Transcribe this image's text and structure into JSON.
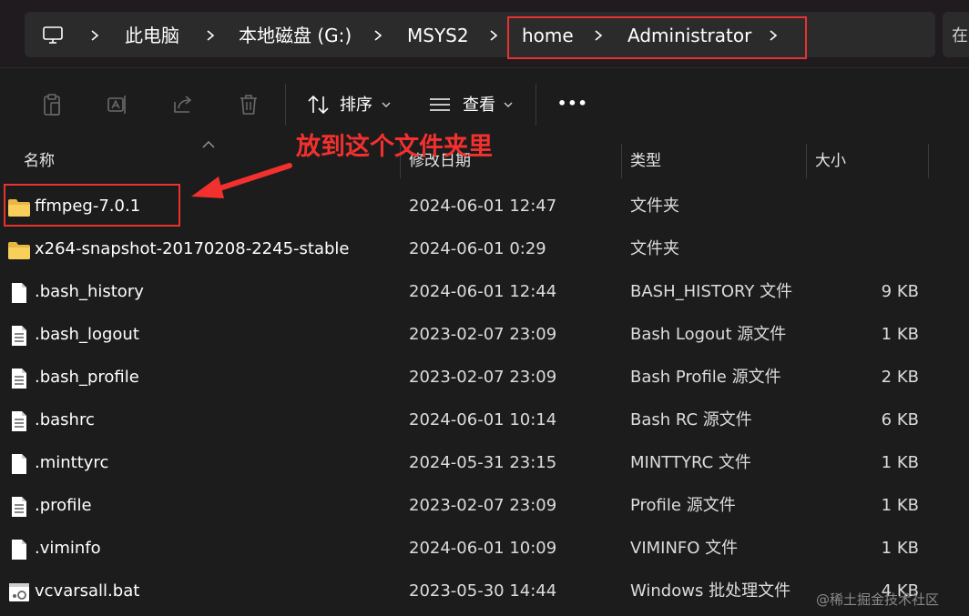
{
  "breadcrumb": {
    "items": [
      "此电脑",
      "本地磁盘 (G:)",
      "MSYS2",
      "home",
      "Administrator"
    ],
    "overflow_text": "在"
  },
  "toolbar": {
    "sort_label": "排序",
    "view_label": "查看",
    "more_label": "•••"
  },
  "columns": {
    "name": "名称",
    "modified": "修改日期",
    "type": "类型",
    "size": "大小"
  },
  "annotation": {
    "text": "放到这个文件夹里",
    "color": "#f2312f"
  },
  "files": [
    {
      "name": "ffmpeg-7.0.1",
      "modified": "2024-06-01 12:47",
      "type": "文件夹",
      "size": "",
      "icon": "folder-icon"
    },
    {
      "name": "x264-snapshot-20170208-2245-stable",
      "modified": "2024-06-01 0:29",
      "type": "文件夹",
      "size": "",
      "icon": "folder-icon"
    },
    {
      "name": ".bash_history",
      "modified": "2024-06-01 12:44",
      "type": "BASH_HISTORY 文件",
      "size": "9 KB",
      "icon": "file-icon"
    },
    {
      "name": ".bash_logout",
      "modified": "2023-02-07 23:09",
      "type": "Bash Logout 源文件",
      "size": "1 KB",
      "icon": "text-file-icon"
    },
    {
      "name": ".bash_profile",
      "modified": "2023-02-07 23:09",
      "type": "Bash Profile 源文件",
      "size": "2 KB",
      "icon": "text-file-icon"
    },
    {
      "name": ".bashrc",
      "modified": "2024-06-01 10:14",
      "type": "Bash RC 源文件",
      "size": "6 KB",
      "icon": "text-file-icon"
    },
    {
      "name": ".minttyrc",
      "modified": "2024-05-31 23:15",
      "type": "MINTTYRC 文件",
      "size": "1 KB",
      "icon": "file-icon"
    },
    {
      "name": ".profile",
      "modified": "2023-02-07 23:09",
      "type": "Profile 源文件",
      "size": "1 KB",
      "icon": "text-file-icon"
    },
    {
      "name": ".viminfo",
      "modified": "2024-06-01 10:09",
      "type": "VIMINFO 文件",
      "size": "1 KB",
      "icon": "file-icon"
    },
    {
      "name": "vcvarsall.bat",
      "modified": "2023-05-30 14:44",
      "type": "Windows 批处理文件",
      "size": "4 KB",
      "icon": "batch-file-icon"
    }
  ],
  "watermark": "@稀土掘金技术社区"
}
